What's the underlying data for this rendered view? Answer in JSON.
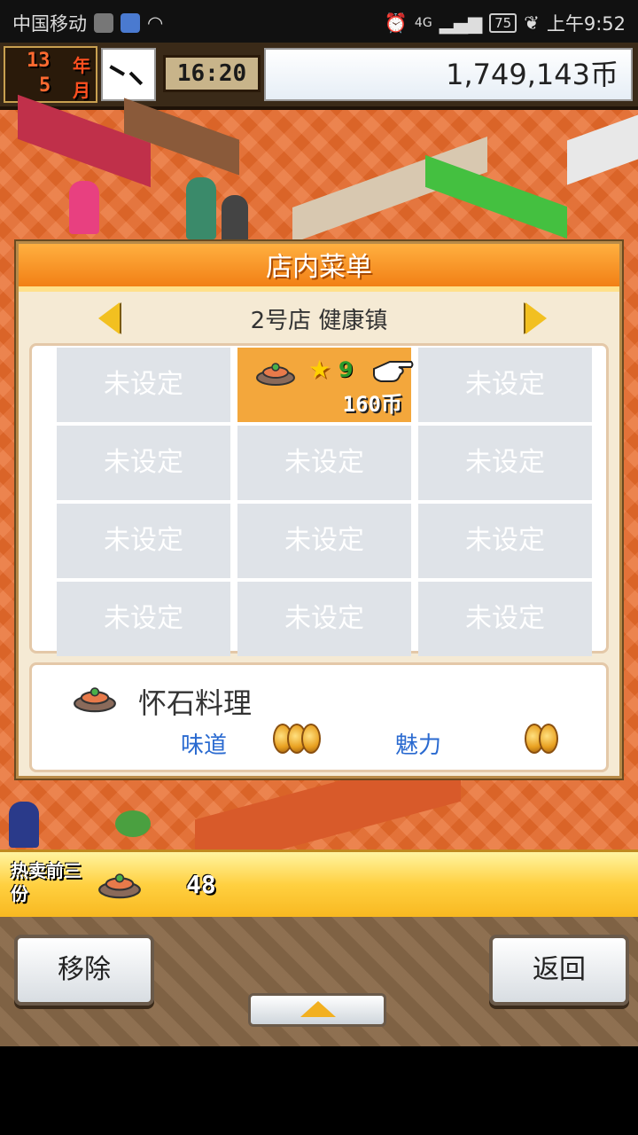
{
  "status_bar": {
    "carrier": "中国移动",
    "network": "4G",
    "battery": "75",
    "time": "上午9:52"
  },
  "hud": {
    "year_num": "13",
    "year_unit": "年",
    "month_num": "5",
    "month_unit": "月",
    "time": "16:20",
    "money": "1,749,143币"
  },
  "dialog": {
    "title": "店内菜单",
    "store": "2号店 健康镇",
    "cells": [
      {
        "label": "未设定"
      },
      {
        "label": "",
        "level": "9",
        "price": "160币",
        "active": true
      },
      {
        "label": "未设定"
      },
      {
        "label": "未设定"
      },
      {
        "label": "未设定"
      },
      {
        "label": "未设定"
      },
      {
        "label": "未设定"
      },
      {
        "label": "未设定"
      },
      {
        "label": "未设定"
      },
      {
        "label": "未设定"
      },
      {
        "label": "未设定"
      },
      {
        "label": "未设定"
      }
    ],
    "info": {
      "dish_name": "怀石料理",
      "taste_label": "味道",
      "taste_coins": 3,
      "charm_label": "魅力",
      "charm_coins": 2
    }
  },
  "bestseller": {
    "label": "热卖前三份",
    "count": "48"
  },
  "buttons": {
    "remove": "移除",
    "back": "返回"
  },
  "colors": {
    "accent": "#f07a10",
    "active_cell": "#f3a73c",
    "empty_cell": "#dfe3e8",
    "label_blue": "#2a6ad0"
  }
}
